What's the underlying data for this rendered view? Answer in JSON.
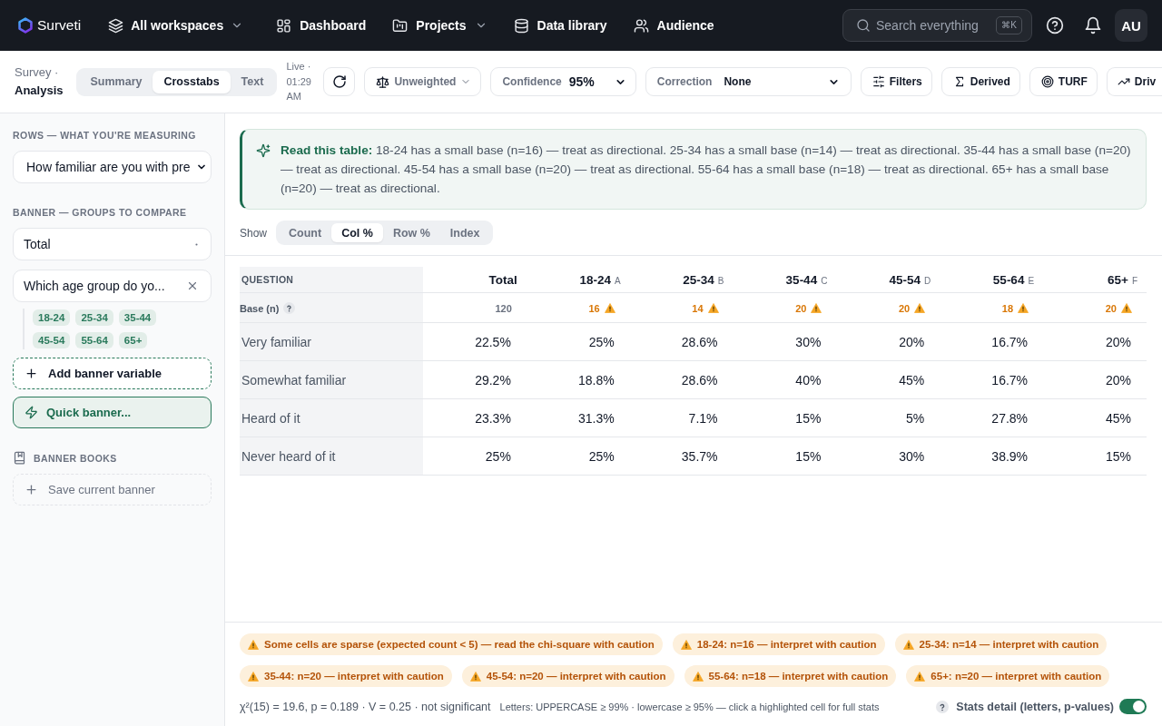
{
  "top_nav": {
    "brand": "Surveti",
    "workspace": "All workspaces",
    "items": [
      {
        "label": "Dashboard",
        "has_menu": false
      },
      {
        "label": "Projects",
        "has_menu": true
      },
      {
        "label": "Data library",
        "has_menu": false
      },
      {
        "label": "Audience",
        "has_menu": false
      }
    ],
    "search": {
      "placeholder": "Search everything",
      "shortcut": "⌘K"
    },
    "avatar": "AU"
  },
  "toolbar": {
    "breadcrumb": "Survey ·",
    "title": "Analysis",
    "view_tabs": [
      {
        "label": "Summary",
        "selected": false
      },
      {
        "label": "Crosstabs",
        "selected": true
      },
      {
        "label": "Text",
        "selected": false
      }
    ],
    "live_status": "Live · 01:29 AM",
    "weighting": "Unweighted",
    "confidence": {
      "label": "Confidence",
      "value": "95%"
    },
    "correction": {
      "label": "Correction",
      "value": "None"
    },
    "actions": [
      "Filters",
      "Derived",
      "TURF",
      "Driv"
    ]
  },
  "sidebar": {
    "rows_heading": "ROWS — WHAT YOU'RE MEASURING",
    "question": "How familiar are you with pre",
    "banner_heading": "BANNER — GROUPS TO COMPARE",
    "banner_variables": [
      {
        "kind": "fixed",
        "label": "Total"
      },
      {
        "kind": "removable",
        "label": "Which age group do yo...",
        "categories": [
          "18-24",
          "25-34",
          "35-44",
          "45-54",
          "55-64",
          "65+"
        ]
      }
    ],
    "add_banner": "Add banner variable",
    "quick_banner": "Quick banner...",
    "books_heading": "BANNER BOOKS",
    "save_banner": "Save current banner"
  },
  "callout": {
    "lead": "Read this table:",
    "text": "18-24 has a small base (n=16) — treat as directional. 25-34 has a small base (n=14) — treat as directional. 35-44 has a small base (n=20) — treat as directional. 45-54 has a small base (n=20) — treat as directional. 55-64 has a small base (n=18) — treat as directional. 65+ has a small base (n=20) — treat as directional."
  },
  "show": {
    "label": "Show",
    "options": [
      {
        "label": "Count",
        "selected": false
      },
      {
        "label": "Col %",
        "selected": true
      },
      {
        "label": "Row %",
        "selected": false
      },
      {
        "label": "Index",
        "selected": false
      }
    ]
  },
  "table": {
    "corner": "QUESTION",
    "columns": [
      {
        "label": "Total"
      },
      {
        "label": "18-24",
        "letter": "A"
      },
      {
        "label": "25-34",
        "letter": "B"
      },
      {
        "label": "35-44",
        "letter": "C"
      },
      {
        "label": "45-54",
        "letter": "D"
      },
      {
        "label": "55-64",
        "letter": "E"
      },
      {
        "label": "65+",
        "letter": "F"
      }
    ],
    "base": {
      "label": "Base (n)",
      "values": [
        {
          "value": "120",
          "small_base": false
        },
        {
          "value": "16",
          "small_base": true
        },
        {
          "value": "14",
          "small_base": true
        },
        {
          "value": "20",
          "small_base": true
        },
        {
          "value": "20",
          "small_base": true
        },
        {
          "value": "18",
          "small_base": true
        },
        {
          "value": "20",
          "small_base": true
        }
      ]
    },
    "rows": [
      {
        "label": "Very familiar",
        "cells": [
          "22.5%",
          "25%",
          "28.6%",
          "30%",
          "20%",
          "16.7%",
          "20%"
        ]
      },
      {
        "label": "Somewhat familiar",
        "cells": [
          "29.2%",
          "18.8%",
          "28.6%",
          "40%",
          "45%",
          "16.7%",
          "20%"
        ]
      },
      {
        "label": "Heard of it",
        "cells": [
          "23.3%",
          "31.3%",
          "7.1%",
          "15%",
          "5%",
          "27.8%",
          "45%"
        ]
      },
      {
        "label": "Never heard of it",
        "cells": [
          "25%",
          "25%",
          "35.7%",
          "15%",
          "30%",
          "38.9%",
          "15%"
        ]
      }
    ]
  },
  "footer": {
    "warnings": [
      "Some cells are sparse (expected count < 5) — read the chi-square with caution",
      "18-24: n=16 — interpret with caution",
      "25-34: n=14 — interpret with caution",
      "35-44: n=20 — interpret with caution",
      "45-54: n=20 — interpret with caution",
      "55-64: n=18 — interpret with caution",
      "65+: n=20 — interpret with caution"
    ],
    "stats": "χ²(15) = 19.6, p = 0.189 · V = 0.25 · not significant",
    "legend": "Letters: UPPERCASE ≥ 99% · lowercase ≥ 95% — click a highlighted cell for full stats",
    "stats_toggle": {
      "label": "Stats detail (letters, p-values)",
      "on": true
    }
  }
}
